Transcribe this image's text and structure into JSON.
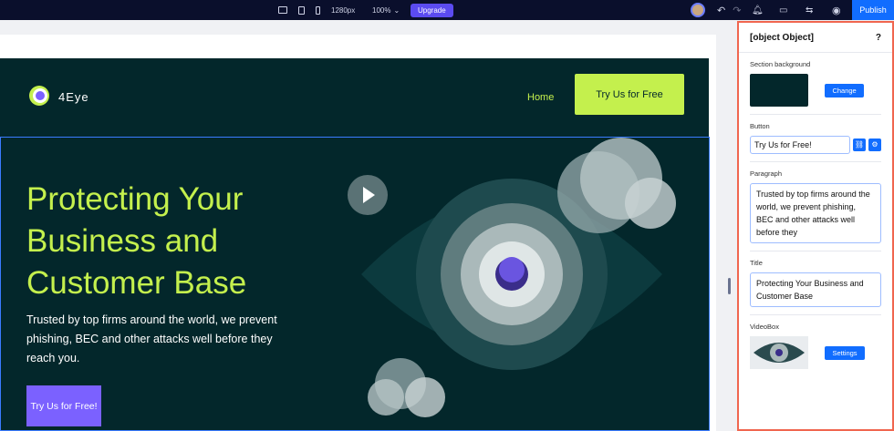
{
  "topbar": {
    "width_label": "1280px",
    "zoom_label": "100%",
    "upgrade_label": "Upgrade",
    "publish_label": "Publish"
  },
  "site": {
    "brand": "4Eye",
    "nav_home": "Home",
    "header_cta": "Try Us for Free",
    "hero": {
      "title": "Protecting Your Business and Customer Base",
      "paragraph": "Trusted by top firms around the world, we prevent phishing, BEC and other attacks well before they reach you.",
      "button": "Try Us for Free!"
    }
  },
  "panel": {
    "title": {
      "label": "Title",
      "value": "Protecting Your Business and Customer Base"
    },
    "help": "?",
    "section_background": {
      "label": "Section background",
      "color": "#03272b",
      "change_label": "Change"
    },
    "button": {
      "label": "Button",
      "value": "Try Us for Free!"
    },
    "paragraph": {
      "label": "Paragraph",
      "value": "Trusted by top firms around the world, we prevent phishing, BEC and other attacks well before they"
    },
    "videobox": {
      "label": "VideoBox",
      "settings_label": "Settings"
    }
  },
  "colors": {
    "accent": "#c4f04d",
    "purple": "#7b61ff",
    "blue": "#116dff"
  }
}
